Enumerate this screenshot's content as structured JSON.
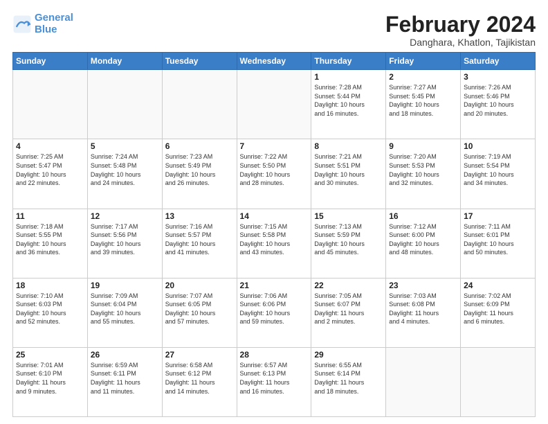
{
  "logo": {
    "line1": "General",
    "line2": "Blue"
  },
  "title": "February 2024",
  "subtitle": "Danghara, Khatlon, Tajikistan",
  "days_header": [
    "Sunday",
    "Monday",
    "Tuesday",
    "Wednesday",
    "Thursday",
    "Friday",
    "Saturday"
  ],
  "weeks": [
    [
      {
        "day": "",
        "info": ""
      },
      {
        "day": "",
        "info": ""
      },
      {
        "day": "",
        "info": ""
      },
      {
        "day": "",
        "info": ""
      },
      {
        "day": "1",
        "info": "Sunrise: 7:28 AM\nSunset: 5:44 PM\nDaylight: 10 hours\nand 16 minutes."
      },
      {
        "day": "2",
        "info": "Sunrise: 7:27 AM\nSunset: 5:45 PM\nDaylight: 10 hours\nand 18 minutes."
      },
      {
        "day": "3",
        "info": "Sunrise: 7:26 AM\nSunset: 5:46 PM\nDaylight: 10 hours\nand 20 minutes."
      }
    ],
    [
      {
        "day": "4",
        "info": "Sunrise: 7:25 AM\nSunset: 5:47 PM\nDaylight: 10 hours\nand 22 minutes."
      },
      {
        "day": "5",
        "info": "Sunrise: 7:24 AM\nSunset: 5:48 PM\nDaylight: 10 hours\nand 24 minutes."
      },
      {
        "day": "6",
        "info": "Sunrise: 7:23 AM\nSunset: 5:49 PM\nDaylight: 10 hours\nand 26 minutes."
      },
      {
        "day": "7",
        "info": "Sunrise: 7:22 AM\nSunset: 5:50 PM\nDaylight: 10 hours\nand 28 minutes."
      },
      {
        "day": "8",
        "info": "Sunrise: 7:21 AM\nSunset: 5:51 PM\nDaylight: 10 hours\nand 30 minutes."
      },
      {
        "day": "9",
        "info": "Sunrise: 7:20 AM\nSunset: 5:53 PM\nDaylight: 10 hours\nand 32 minutes."
      },
      {
        "day": "10",
        "info": "Sunrise: 7:19 AM\nSunset: 5:54 PM\nDaylight: 10 hours\nand 34 minutes."
      }
    ],
    [
      {
        "day": "11",
        "info": "Sunrise: 7:18 AM\nSunset: 5:55 PM\nDaylight: 10 hours\nand 36 minutes."
      },
      {
        "day": "12",
        "info": "Sunrise: 7:17 AM\nSunset: 5:56 PM\nDaylight: 10 hours\nand 39 minutes."
      },
      {
        "day": "13",
        "info": "Sunrise: 7:16 AM\nSunset: 5:57 PM\nDaylight: 10 hours\nand 41 minutes."
      },
      {
        "day": "14",
        "info": "Sunrise: 7:15 AM\nSunset: 5:58 PM\nDaylight: 10 hours\nand 43 minutes."
      },
      {
        "day": "15",
        "info": "Sunrise: 7:13 AM\nSunset: 5:59 PM\nDaylight: 10 hours\nand 45 minutes."
      },
      {
        "day": "16",
        "info": "Sunrise: 7:12 AM\nSunset: 6:00 PM\nDaylight: 10 hours\nand 48 minutes."
      },
      {
        "day": "17",
        "info": "Sunrise: 7:11 AM\nSunset: 6:01 PM\nDaylight: 10 hours\nand 50 minutes."
      }
    ],
    [
      {
        "day": "18",
        "info": "Sunrise: 7:10 AM\nSunset: 6:03 PM\nDaylight: 10 hours\nand 52 minutes."
      },
      {
        "day": "19",
        "info": "Sunrise: 7:09 AM\nSunset: 6:04 PM\nDaylight: 10 hours\nand 55 minutes."
      },
      {
        "day": "20",
        "info": "Sunrise: 7:07 AM\nSunset: 6:05 PM\nDaylight: 10 hours\nand 57 minutes."
      },
      {
        "day": "21",
        "info": "Sunrise: 7:06 AM\nSunset: 6:06 PM\nDaylight: 10 hours\nand 59 minutes."
      },
      {
        "day": "22",
        "info": "Sunrise: 7:05 AM\nSunset: 6:07 PM\nDaylight: 11 hours\nand 2 minutes."
      },
      {
        "day": "23",
        "info": "Sunrise: 7:03 AM\nSunset: 6:08 PM\nDaylight: 11 hours\nand 4 minutes."
      },
      {
        "day": "24",
        "info": "Sunrise: 7:02 AM\nSunset: 6:09 PM\nDaylight: 11 hours\nand 6 minutes."
      }
    ],
    [
      {
        "day": "25",
        "info": "Sunrise: 7:01 AM\nSunset: 6:10 PM\nDaylight: 11 hours\nand 9 minutes."
      },
      {
        "day": "26",
        "info": "Sunrise: 6:59 AM\nSunset: 6:11 PM\nDaylight: 11 hours\nand 11 minutes."
      },
      {
        "day": "27",
        "info": "Sunrise: 6:58 AM\nSunset: 6:12 PM\nDaylight: 11 hours\nand 14 minutes."
      },
      {
        "day": "28",
        "info": "Sunrise: 6:57 AM\nSunset: 6:13 PM\nDaylight: 11 hours\nand 16 minutes."
      },
      {
        "day": "29",
        "info": "Sunrise: 6:55 AM\nSunset: 6:14 PM\nDaylight: 11 hours\nand 18 minutes."
      },
      {
        "day": "",
        "info": ""
      },
      {
        "day": "",
        "info": ""
      }
    ]
  ]
}
